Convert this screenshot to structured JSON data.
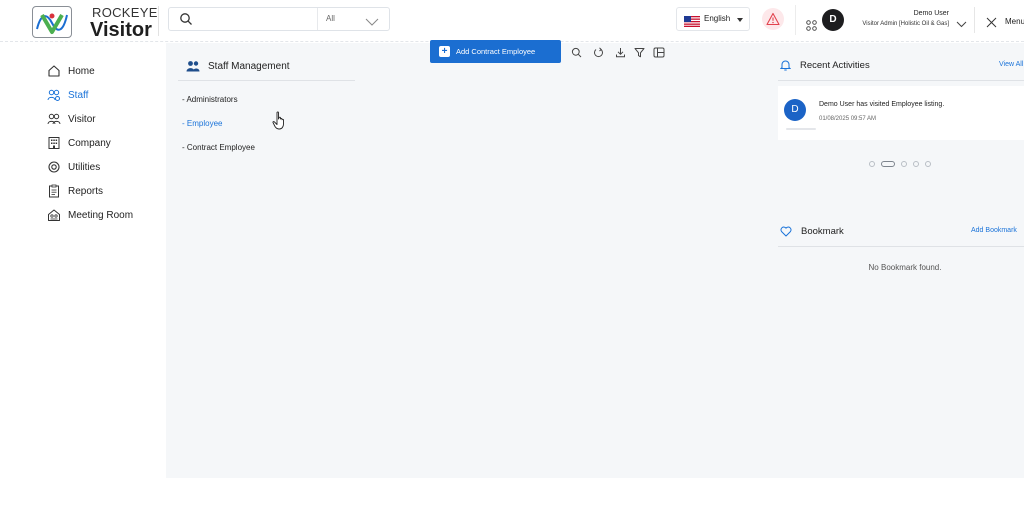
{
  "brand": {
    "name_top": "ROCKEYE",
    "name_bottom": "Visitor",
    "colors": {
      "green": "#4caf50",
      "blue": "#1b6ed1",
      "red": "#d9323c"
    }
  },
  "header": {
    "search": {
      "icon": "search-icon",
      "placeholder": "",
      "filter_value": "All"
    },
    "language": {
      "label": "English",
      "flag": "us-flag-icon"
    },
    "alert_icon": "warning-icon",
    "apps_icon": "apps-grid-icon",
    "user": {
      "initial": "D",
      "name": "Demo User",
      "role": "Visitor Admin [Holistic Oil & Gas]"
    },
    "menu": {
      "label": "Menu",
      "icon": "close-icon"
    }
  },
  "sidebar": {
    "items": [
      {
        "label": "Home",
        "icon": "home-icon",
        "active": false
      },
      {
        "label": "Staff",
        "icon": "staff-icon",
        "active": true
      },
      {
        "label": "Visitor",
        "icon": "visitor-icon",
        "active": false
      },
      {
        "label": "Company",
        "icon": "company-icon",
        "active": false
      },
      {
        "label": "Utilities",
        "icon": "utilities-icon",
        "active": false
      },
      {
        "label": "Reports",
        "icon": "reports-icon",
        "active": false
      },
      {
        "label": "Meeting Room",
        "icon": "meeting-room-icon",
        "active": false
      }
    ]
  },
  "main": {
    "section_title": "Staff Management",
    "links": [
      {
        "label": "- Administrators",
        "active": false
      },
      {
        "label": "- Employee",
        "active": true
      },
      {
        "label": "- Contract Employee",
        "active": false
      }
    ],
    "toolbar": {
      "add_label": "Add Contract Employee",
      "icons": [
        "search-icon",
        "refresh-icon",
        "download-icon",
        "filter-icon",
        "columns-icon"
      ]
    }
  },
  "right_panel": {
    "recent": {
      "title": "Recent Activities",
      "view_all": "View All",
      "items": [
        {
          "initial": "D",
          "text": "Demo User has visited Employee listing.",
          "time": "01/08/2025 09:57 AM"
        }
      ],
      "carousel": {
        "count": 5,
        "active_index": 1
      }
    },
    "bookmark": {
      "title": "Bookmark",
      "add_label": "Add Bookmark",
      "empty_text": "No Bookmark found."
    }
  }
}
